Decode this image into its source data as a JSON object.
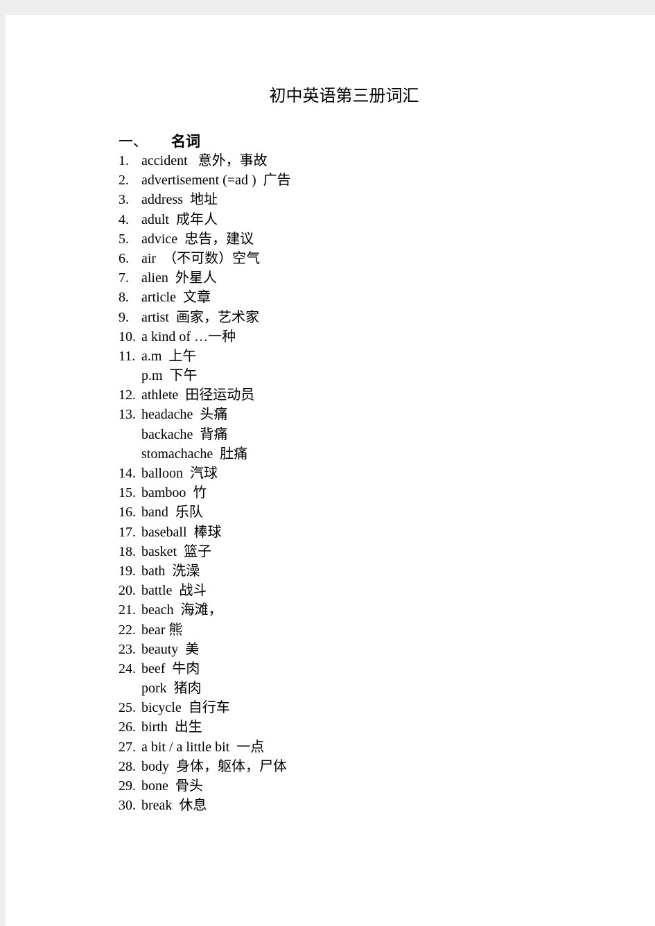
{
  "title": "初中英语第三册词汇",
  "section": {
    "number": "一、",
    "label": "名词"
  },
  "items": [
    {
      "num": "1.",
      "text": "accident   意外，事故"
    },
    {
      "num": "2.",
      "text": "advertisement (=ad )  广告"
    },
    {
      "num": "3.",
      "text": "address  地址"
    },
    {
      "num": "4.",
      "text": "adult  成年人"
    },
    {
      "num": "5.",
      "text": "advice  忠告，建议"
    },
    {
      "num": "6.",
      "text": "air  （不可数）空气"
    },
    {
      "num": "7.",
      "text": "alien  外星人"
    },
    {
      "num": "8.",
      "text": "article  文章"
    },
    {
      "num": "9.",
      "text": "artist  画家，艺术家"
    },
    {
      "num": "10.",
      "text": "a kind of …一种"
    },
    {
      "num": "11.",
      "text": "a.m  上午"
    },
    {
      "num": "",
      "text": "p.m  下午"
    },
    {
      "num": "12.",
      "text": "athlete  田径运动员"
    },
    {
      "num": "13.",
      "text": "headache  头痛"
    },
    {
      "num": "",
      "text": "backache  背痛"
    },
    {
      "num": "",
      "text": "stomachache  肚痛"
    },
    {
      "num": "14.",
      "text": "balloon  汽球"
    },
    {
      "num": "15.",
      "text": "bamboo  竹"
    },
    {
      "num": "16.",
      "text": "band  乐队"
    },
    {
      "num": "17.",
      "text": "baseball  棒球"
    },
    {
      "num": "18.",
      "text": "basket  篮子"
    },
    {
      "num": "19.",
      "text": "bath  洗澡"
    },
    {
      "num": "20.",
      "text": "battle  战斗"
    },
    {
      "num": "21.",
      "text": "beach  海滩，"
    },
    {
      "num": "22.",
      "text": "bear 熊"
    },
    {
      "num": "23.",
      "text": "beauty  美"
    },
    {
      "num": "24.",
      "text": "beef  牛肉"
    },
    {
      "num": "",
      "text": "pork  猪肉"
    },
    {
      "num": "25.",
      "text": "bicycle  自行车"
    },
    {
      "num": "26.",
      "text": "birth  出生"
    },
    {
      "num": "27.",
      "text": "a bit / a little bit  一点"
    },
    {
      "num": "28.",
      "text": "body  身体，躯体，尸体"
    },
    {
      "num": "29.",
      "text": "bone  骨头"
    },
    {
      "num": "30.",
      "text": "break  休息"
    }
  ]
}
